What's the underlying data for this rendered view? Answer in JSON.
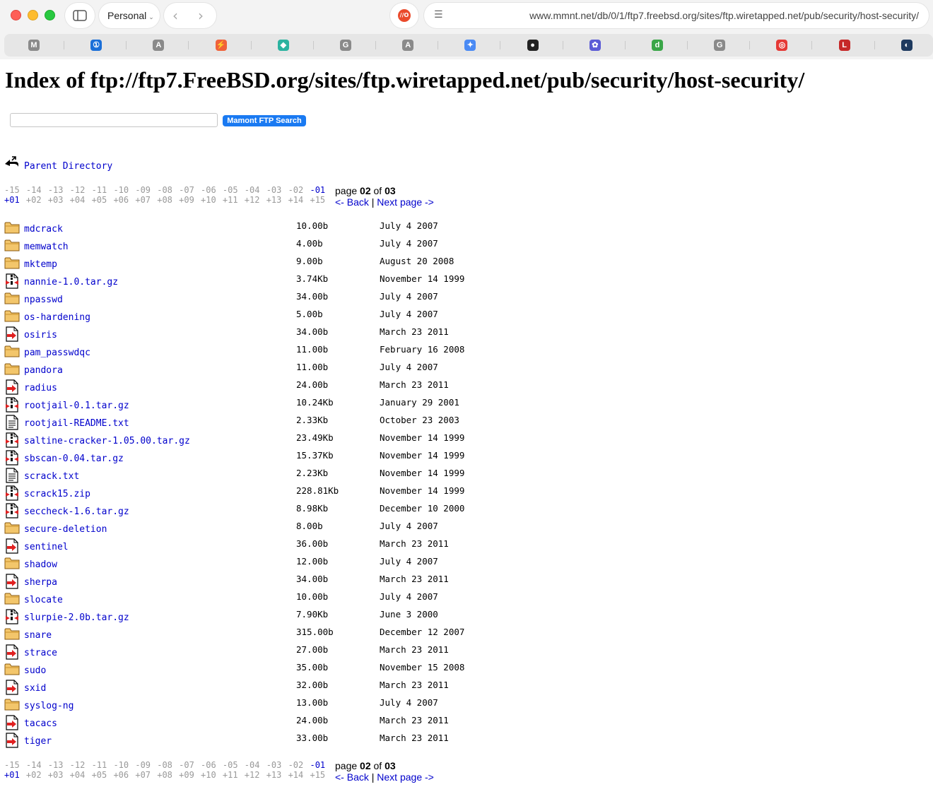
{
  "browser": {
    "profile_label": "Personal",
    "ext_label": "//O",
    "url": "www.mmnt.net/db/0/1/ftp7.freebsd.org/sites/ftp.wiretapped.net/pub/security/host-security/",
    "favorites": [
      {
        "name": "m-favicon",
        "glyph": "M",
        "color": "#8a8a8a"
      },
      {
        "name": "1password-favicon",
        "glyph": "①",
        "color": "#1a6fd8"
      },
      {
        "name": "a-favicon",
        "glyph": "A",
        "color": "#8a8a8a"
      },
      {
        "name": "bolt-favicon",
        "glyph": "⚡",
        "color": "#f0623a"
      },
      {
        "name": "layers-favicon",
        "glyph": "◆",
        "color": "#2bb3a0"
      },
      {
        "name": "g-favicon",
        "glyph": "G",
        "color": "#8a8a8a"
      },
      {
        "name": "a2-favicon",
        "glyph": "A",
        "color": "#8a8a8a"
      },
      {
        "name": "sparkle-favicon",
        "glyph": "✦",
        "color": "#4a8af4"
      },
      {
        "name": "dark-favicon",
        "glyph": "●",
        "color": "#222222"
      },
      {
        "name": "gear-favicon",
        "glyph": "✿",
        "color": "#5b5bd6"
      },
      {
        "name": "d-favicon",
        "glyph": "d",
        "color": "#3aa648"
      },
      {
        "name": "g2-favicon",
        "glyph": "G",
        "color": "#8a8a8a"
      },
      {
        "name": "target-favicon",
        "glyph": "◎",
        "color": "#e53935"
      },
      {
        "name": "l-favicon",
        "glyph": "L",
        "color": "#c62828"
      },
      {
        "name": "circle-favicon",
        "glyph": "◐",
        "color": "#1e3a5f"
      }
    ]
  },
  "page": {
    "title": "Index of ftp://ftp7.FreeBSD.org/sites/ftp.wiretapped.net/pub/security/host-security/",
    "search_button": "Mamont FTP Search",
    "search_value": "",
    "parent_link": "Parent Directory",
    "pager": {
      "neg": [
        "-15",
        "-14",
        "-13",
        "-12",
        "-11",
        "-10",
        "-09",
        "-08",
        "-07",
        "-06",
        "-05",
        "-04",
        "-03",
        "-02",
        "-01"
      ],
      "pos": [
        "+01",
        "+02",
        "+03",
        "+04",
        "+05",
        "+06",
        "+07",
        "+08",
        "+09",
        "+10",
        "+11",
        "+12",
        "+13",
        "+14",
        "+15"
      ],
      "page_word": "page",
      "current": "02",
      "of_word": "of",
      "total": "03",
      "back": "<- Back",
      "sep": "|",
      "next": "Next page ->"
    },
    "files": [
      {
        "name": "mdcrack",
        "size": "10.00b",
        "date": "July 4 2007",
        "type": "folder"
      },
      {
        "name": "memwatch",
        "size": "4.00b",
        "date": "July 4 2007",
        "type": "folder"
      },
      {
        "name": "mktemp",
        "size": "9.00b",
        "date": "August 20 2008",
        "type": "folder"
      },
      {
        "name": "nannie-1.0.tar.gz",
        "size": "3.74Kb",
        "date": "November 14 1999",
        "type": "archive"
      },
      {
        "name": "npasswd",
        "size": "34.00b",
        "date": "July 4 2007",
        "type": "folder"
      },
      {
        "name": "os-hardening",
        "size": "5.00b",
        "date": "July 4 2007",
        "type": "folder"
      },
      {
        "name": "osiris",
        "size": "34.00b",
        "date": "March 23 2011",
        "type": "link"
      },
      {
        "name": "pam_passwdqc",
        "size": "11.00b",
        "date": "February 16 2008",
        "type": "folder"
      },
      {
        "name": "pandora",
        "size": "11.00b",
        "date": "July 4 2007",
        "type": "folder"
      },
      {
        "name": "radius",
        "size": "24.00b",
        "date": "March 23 2011",
        "type": "link"
      },
      {
        "name": "rootjail-0.1.tar.gz",
        "size": "10.24Kb",
        "date": "January 29 2001",
        "type": "archive"
      },
      {
        "name": "rootjail-README.txt",
        "size": "2.33Kb",
        "date": "October 23 2003",
        "type": "text"
      },
      {
        "name": "saltine-cracker-1.05.00.tar.gz",
        "size": "23.49Kb",
        "date": "November 14 1999",
        "type": "archive"
      },
      {
        "name": "sbscan-0.04.tar.gz",
        "size": "15.37Kb",
        "date": "November 14 1999",
        "type": "archive"
      },
      {
        "name": "scrack.txt",
        "size": "2.23Kb",
        "date": "November 14 1999",
        "type": "text"
      },
      {
        "name": "scrack15.zip",
        "size": "228.81Kb",
        "date": "November 14 1999",
        "type": "archive"
      },
      {
        "name": "seccheck-1.6.tar.gz",
        "size": "8.98Kb",
        "date": "December 10 2000",
        "type": "archive"
      },
      {
        "name": "secure-deletion",
        "size": "8.00b",
        "date": "July 4 2007",
        "type": "folder"
      },
      {
        "name": "sentinel",
        "size": "36.00b",
        "date": "March 23 2011",
        "type": "link"
      },
      {
        "name": "shadow",
        "size": "12.00b",
        "date": "July 4 2007",
        "type": "folder"
      },
      {
        "name": "sherpa",
        "size": "34.00b",
        "date": "March 23 2011",
        "type": "link"
      },
      {
        "name": "slocate",
        "size": "10.00b",
        "date": "July 4 2007",
        "type": "folder"
      },
      {
        "name": "slurpie-2.0b.tar.gz",
        "size": "7.90Kb",
        "date": "June 3 2000",
        "type": "archive"
      },
      {
        "name": "snare",
        "size": "315.00b",
        "date": "December 12 2007",
        "type": "folder"
      },
      {
        "name": "strace",
        "size": "27.00b",
        "date": "March 23 2011",
        "type": "link"
      },
      {
        "name": "sudo",
        "size": "35.00b",
        "date": "November 15 2008",
        "type": "folder"
      },
      {
        "name": "sxid",
        "size": "32.00b",
        "date": "March 23 2011",
        "type": "link"
      },
      {
        "name": "syslog-ng",
        "size": "13.00b",
        "date": "July 4 2007",
        "type": "folder"
      },
      {
        "name": "tacacs",
        "size": "24.00b",
        "date": "March 23 2011",
        "type": "link"
      },
      {
        "name": "tiger",
        "size": "33.00b",
        "date": "March 23 2011",
        "type": "link"
      }
    ]
  }
}
